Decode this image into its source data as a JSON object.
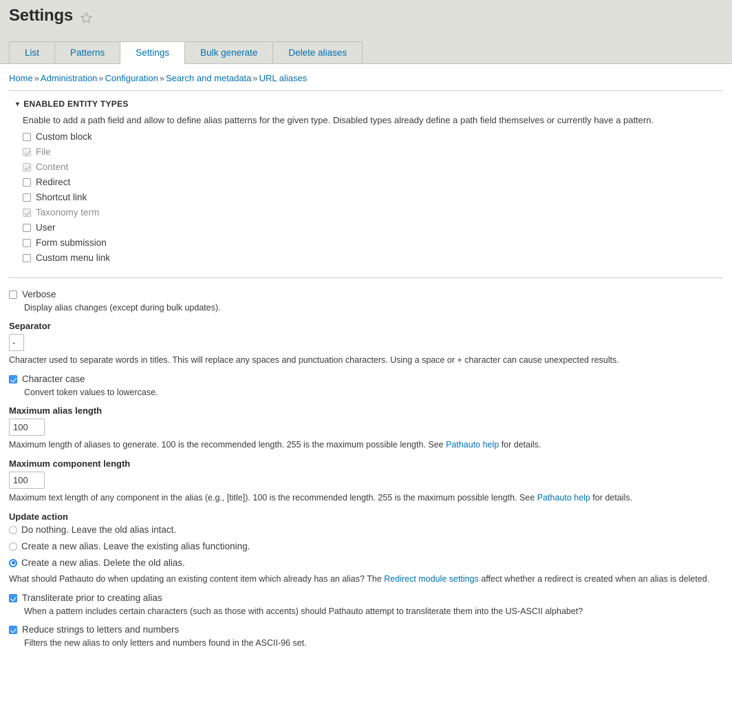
{
  "header": {
    "title": "Settings",
    "star_icon": "star-outline-icon",
    "star_title": "Add to favorites"
  },
  "tabs": [
    {
      "label": "List",
      "active": false
    },
    {
      "label": "Patterns",
      "active": false
    },
    {
      "label": "Settings",
      "active": true
    },
    {
      "label": "Bulk generate",
      "active": false
    },
    {
      "label": "Delete aliases",
      "active": false
    }
  ],
  "breadcrumb": {
    "items": [
      "Home",
      "Administration",
      "Configuration",
      "Search and metadata",
      "URL aliases"
    ],
    "separator": "»"
  },
  "entity_types": {
    "legend": "ENABLED ENTITY TYPES",
    "arrow": "▼",
    "description": "Enable to add a path field and allow to define alias patterns for the given type. Disabled types already define a path field themselves or currently have a pattern.",
    "items": [
      {
        "label": "Custom block",
        "checked": false,
        "disabled": false
      },
      {
        "label": "File",
        "checked": true,
        "disabled": true
      },
      {
        "label": "Content",
        "checked": true,
        "disabled": true
      },
      {
        "label": "Redirect",
        "checked": false,
        "disabled": false
      },
      {
        "label": "Shortcut link",
        "checked": false,
        "disabled": false
      },
      {
        "label": "Taxonomy term",
        "checked": true,
        "disabled": true
      },
      {
        "label": "User",
        "checked": false,
        "disabled": false
      },
      {
        "label": "Form submission",
        "checked": false,
        "disabled": false
      },
      {
        "label": "Custom menu link",
        "checked": false,
        "disabled": false
      }
    ]
  },
  "verbose": {
    "label": "Verbose",
    "checked": false,
    "description": "Display alias changes (except during bulk updates)."
  },
  "separator_field": {
    "label": "Separator",
    "value": "-",
    "description_before": "Character used to separate words in titles. This will replace any spaces and punctuation characters. Using a space or + character can cause unexpected results."
  },
  "character_case": {
    "label": "Character case",
    "checked": true,
    "description": "Convert token values to lowercase."
  },
  "max_alias_length": {
    "label": "Maximum alias length",
    "value": "100",
    "desc_part1": "Maximum length of aliases to generate. 100 is the recommended length. 255 is the maximum possible length. See ",
    "link": "Pathauto help",
    "desc_part2": " for details."
  },
  "max_component_length": {
    "label": "Maximum component length",
    "value": "100",
    "desc_part1": "Maximum text length of any component in the alias (e.g., [title]). 100 is the recommended length. 255 is the maximum possible length. See ",
    "link": "Pathauto help",
    "desc_part2": " for details."
  },
  "update_action": {
    "label": "Update action",
    "options": [
      {
        "label": "Do nothing. Leave the old alias intact.",
        "selected": false
      },
      {
        "label": "Create a new alias. Leave the existing alias functioning.",
        "selected": false
      },
      {
        "label": "Create a new alias. Delete the old alias.",
        "selected": true
      }
    ],
    "desc_part1": "What should Pathauto do when updating an existing content item which already has an alias? The ",
    "link": "Redirect module settings",
    "desc_part2": " affect whether a redirect is created when an alias is deleted."
  },
  "transliterate": {
    "label": "Transliterate prior to creating alias",
    "checked": true,
    "description": "When a pattern includes certain characters (such as those with accents) should Pathauto attempt to transliterate them into the US-ASCII alphabet?"
  },
  "reduce_strings": {
    "label": "Reduce strings to letters and numbers",
    "checked": true,
    "description": "Filters the new alias to only letters and numbers found in the ASCII-96 set."
  },
  "colors": {
    "link": "#0071b3",
    "header_bg": "#e0e0da",
    "accent_checkbox": "#3b99fc",
    "text": "#3b3b3b"
  }
}
